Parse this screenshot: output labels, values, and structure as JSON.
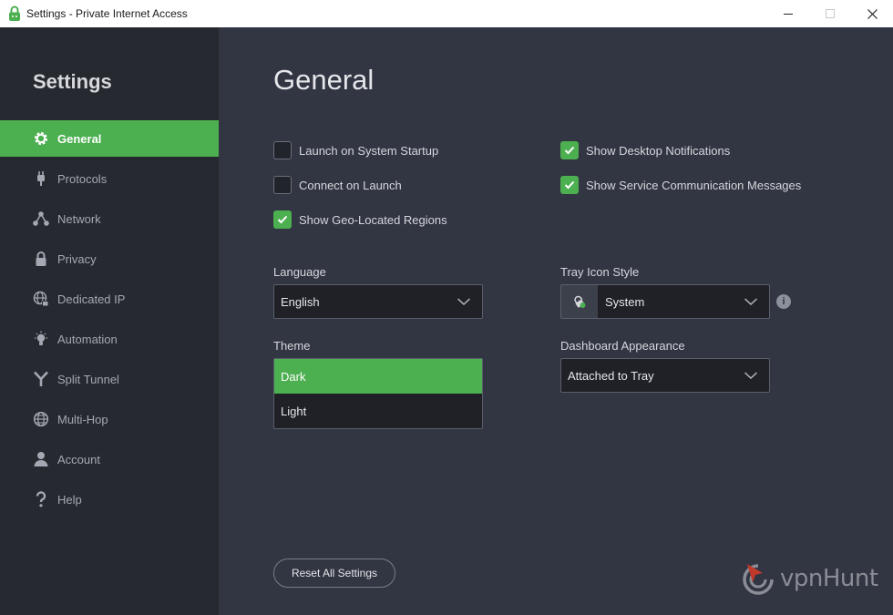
{
  "window": {
    "title": "Settings - Private Internet Access"
  },
  "sidebar": {
    "title": "Settings",
    "items": [
      {
        "label": "General",
        "icon": "gear-icon",
        "active": true
      },
      {
        "label": "Protocols",
        "icon": "plug-icon",
        "active": false
      },
      {
        "label": "Network",
        "icon": "network-icon",
        "active": false
      },
      {
        "label": "Privacy",
        "icon": "lock-icon",
        "active": false
      },
      {
        "label": "Dedicated IP",
        "icon": "globe-lock-icon",
        "active": false
      },
      {
        "label": "Automation",
        "icon": "bulb-icon",
        "active": false
      },
      {
        "label": "Split Tunnel",
        "icon": "split-icon",
        "active": false
      },
      {
        "label": "Multi-Hop",
        "icon": "globe-icon",
        "active": false
      },
      {
        "label": "Account",
        "icon": "user-icon",
        "active": false
      },
      {
        "label": "Help",
        "icon": "question-icon",
        "active": false
      }
    ]
  },
  "main": {
    "title": "General",
    "checkboxes": {
      "launch_on_startup": {
        "label": "Launch on System Startup",
        "checked": false
      },
      "connect_on_launch": {
        "label": "Connect on Launch",
        "checked": false
      },
      "show_geo_regions": {
        "label": "Show Geo-Located Regions",
        "checked": true
      },
      "desktop_notifications": {
        "label": "Show Desktop Notifications",
        "checked": true
      },
      "service_messages": {
        "label": "Show Service Communication Messages",
        "checked": true
      }
    },
    "language": {
      "label": "Language",
      "value": "English"
    },
    "tray_icon_style": {
      "label": "Tray Icon Style",
      "value": "System"
    },
    "theme": {
      "label": "Theme",
      "options": [
        "Dark",
        "Light"
      ],
      "selected": "Dark"
    },
    "dashboard_appearance": {
      "label": "Dashboard Appearance",
      "value": "Attached to Tray"
    },
    "reset_button": "Reset All Settings"
  },
  "watermark": {
    "text": "vpnHunt"
  },
  "colors": {
    "accent": "#4caf50",
    "sidebar_bg": "#272930",
    "main_bg": "#323542",
    "field_bg": "#1f2127"
  }
}
